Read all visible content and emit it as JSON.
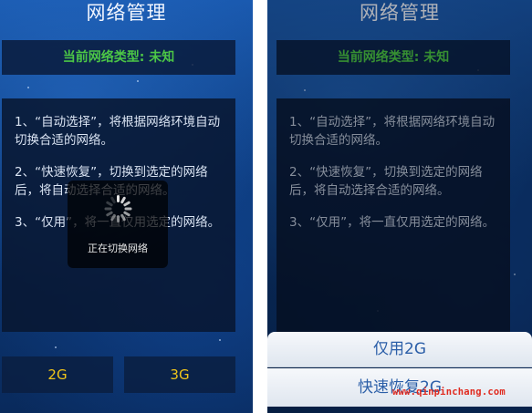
{
  "left_screen": {
    "title": "网络管理",
    "network_type_label": "当前网络类型: 未知",
    "instructions": [
      "1、“自动选择”，将根据网络环境自动切换合适的网络。",
      "2、“快速恢复”，切换到选定的网络后，将自动选择合适的网络。",
      "3、“仅用”，将一直仅用选定的网络。"
    ],
    "loading_toast": "正在切换网络",
    "buttons": {
      "btn_2g": "2G",
      "btn_3g": "3G"
    }
  },
  "right_screen": {
    "title": "网络管理",
    "network_type_label": "当前网络类型: 未知",
    "instructions": [
      "1、“自动选择”，将根据网络环境自动切换合适的网络。",
      "2、“快速恢复”，切换到选定的网络后，将自动选择合适的网络。",
      "3、“仅用”，将一直仅用选定的网络。"
    ],
    "action_sheet": {
      "only_2g": "仅用2G",
      "quick_restore_2g": "快速恢复2G"
    }
  },
  "watermark": "www.qinpinchang.com",
  "colors": {
    "status_green": "#4cc646",
    "button_text_yellow": "#f0c51a",
    "sheet_text_blue": "#2c5fa8",
    "watermark_red": "#e02a1f"
  }
}
